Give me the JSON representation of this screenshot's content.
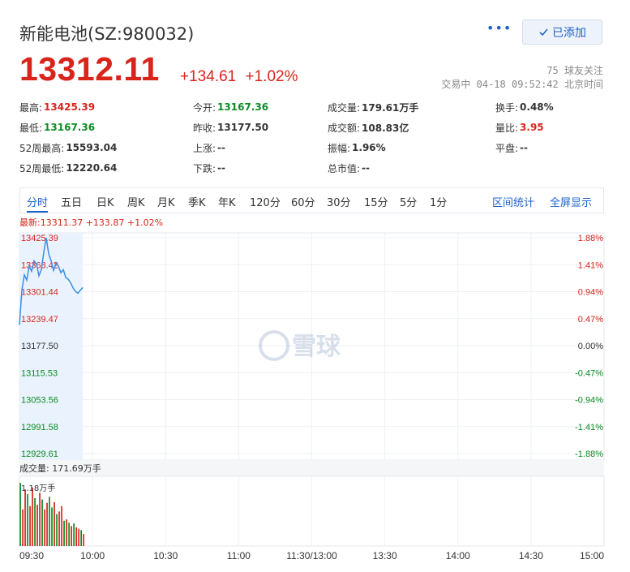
{
  "header": {
    "title": "新能电池(SZ:980032)",
    "more_label": "•••",
    "added_label": "已添加",
    "followers": "75 球友关注",
    "trade_status": "交易中 04-18 09:52:42 北京时间"
  },
  "price": {
    "current": "13312.11",
    "change": "+134.61",
    "change_pct": "+1.02%"
  },
  "quote": {
    "high_label": "最高:",
    "high": "13425.39",
    "low_label": "最低:",
    "low": "13167.36",
    "w52high_label": "52周最高:",
    "w52high": "15593.04",
    "w52low_label": "52周最低:",
    "w52low": "12220.64",
    "open_label": "今开:",
    "open": "13167.36",
    "prev_label": "昨收:",
    "prev": "13177.50",
    "up_label": "上涨:",
    "up": "--",
    "down_label": "下跌:",
    "down": "--",
    "volume_label": "成交量:",
    "volume": "179.61万手",
    "amount_label": "成交额:",
    "amount": "108.83亿",
    "amplitude_label": "振幅:",
    "amplitude": "1.96%",
    "mcap_label": "总市值:",
    "mcap": "--",
    "turnover_label": "换手:",
    "turnover": "0.48%",
    "volratio_label": "量比:",
    "volratio": "3.95",
    "flat_label": "平盘:",
    "flat": "--"
  },
  "tabs": [
    "分时",
    "五日",
    "日K",
    "周K",
    "月K",
    "季K",
    "年K",
    "120分",
    "60分",
    "30分",
    "15分",
    "5分",
    "1分"
  ],
  "tab_links": [
    "区间统计",
    "全屏显示"
  ],
  "active_tab": "分时",
  "latest": "最新:13311.37 +133.87 +1.02%",
  "watermark": "雪球",
  "volume_label": "成交量: 171.69万手",
  "volume_max_label": "1.18万手",
  "colors": {
    "up": "#d9241b",
    "down": "#0a8d22",
    "accent": "#1e63ca",
    "line": "#3a8ee6"
  },
  "chart_data": {
    "type": "line",
    "y_left_ticks": [
      "13425.39",
      "13363.42",
      "13301.44",
      "13239.47",
      "13177.50",
      "13115.53",
      "13053.56",
      "12991.58",
      "12929.61"
    ],
    "y_right_ticks": [
      "1.88%",
      "1.41%",
      "0.94%",
      "0.47%",
      "0.00%",
      "-0.47%",
      "-0.94%",
      "-1.41%",
      "-1.88%"
    ],
    "x_ticks": [
      "09:30",
      "10:00",
      "10:30",
      "11:00",
      "11:30/13:00",
      "13:30",
      "14:00",
      "14:30",
      "15:00"
    ],
    "ylim": [
      12929.61,
      13425.39
    ],
    "prev_close": 13177.5,
    "series": [
      {
        "values": [
          13225,
          13305,
          13340,
          13328,
          13360,
          13348,
          13372,
          13365,
          13338,
          13352,
          13392,
          13425,
          13388,
          13372,
          13350,
          13368,
          13360,
          13345,
          13352,
          13334,
          13330,
          13322,
          13310,
          13302,
          13298,
          13305,
          13311
        ]
      }
    ],
    "volume_ratio": [
      0.95,
      0.55,
      0.85,
      0.78,
      0.6,
      0.88,
      0.72,
      0.62,
      0.8,
      0.7,
      0.55,
      0.65,
      0.74,
      0.58,
      0.66,
      0.48,
      0.52,
      0.6,
      0.38,
      0.4,
      0.35,
      0.3,
      0.34,
      0.28,
      0.26,
      0.24,
      0.18
    ],
    "volume_color": [
      "down",
      "up",
      "up",
      "down",
      "up",
      "up",
      "down",
      "up",
      "up",
      "down",
      "up",
      "up",
      "down",
      "down",
      "up",
      "down",
      "up",
      "up",
      "down",
      "up",
      "down",
      "up",
      "down",
      "up",
      "up",
      "down",
      "up"
    ]
  }
}
